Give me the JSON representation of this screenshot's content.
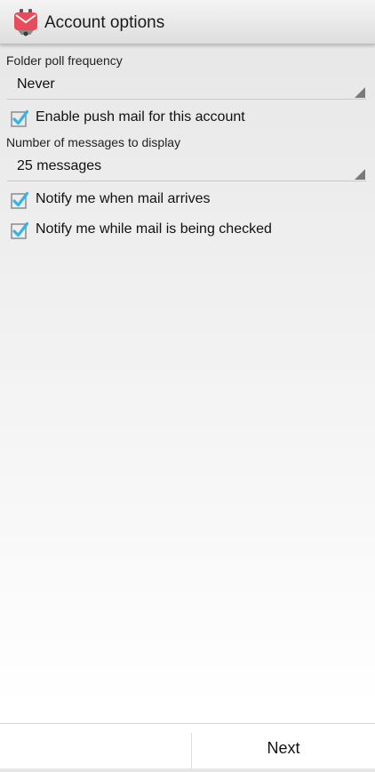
{
  "action_bar": {
    "title": "Account options",
    "icon": "k9-mail-app-icon"
  },
  "folder_poll": {
    "label": "Folder poll frequency",
    "value": "Never"
  },
  "push_mail": {
    "label": "Enable push mail for this account",
    "checked": true
  },
  "message_count": {
    "label": "Number of messages to display",
    "value": "25 messages"
  },
  "notify_arrival": {
    "label": "Notify me when mail arrives",
    "checked": true
  },
  "notify_checking": {
    "label": "Notify me while mail is being checked",
    "checked": true
  },
  "bottom_bar": {
    "next_label": "Next"
  },
  "colors": {
    "checkbox_accent": "#33b5e5",
    "app_icon_red": "#e84c5a"
  }
}
